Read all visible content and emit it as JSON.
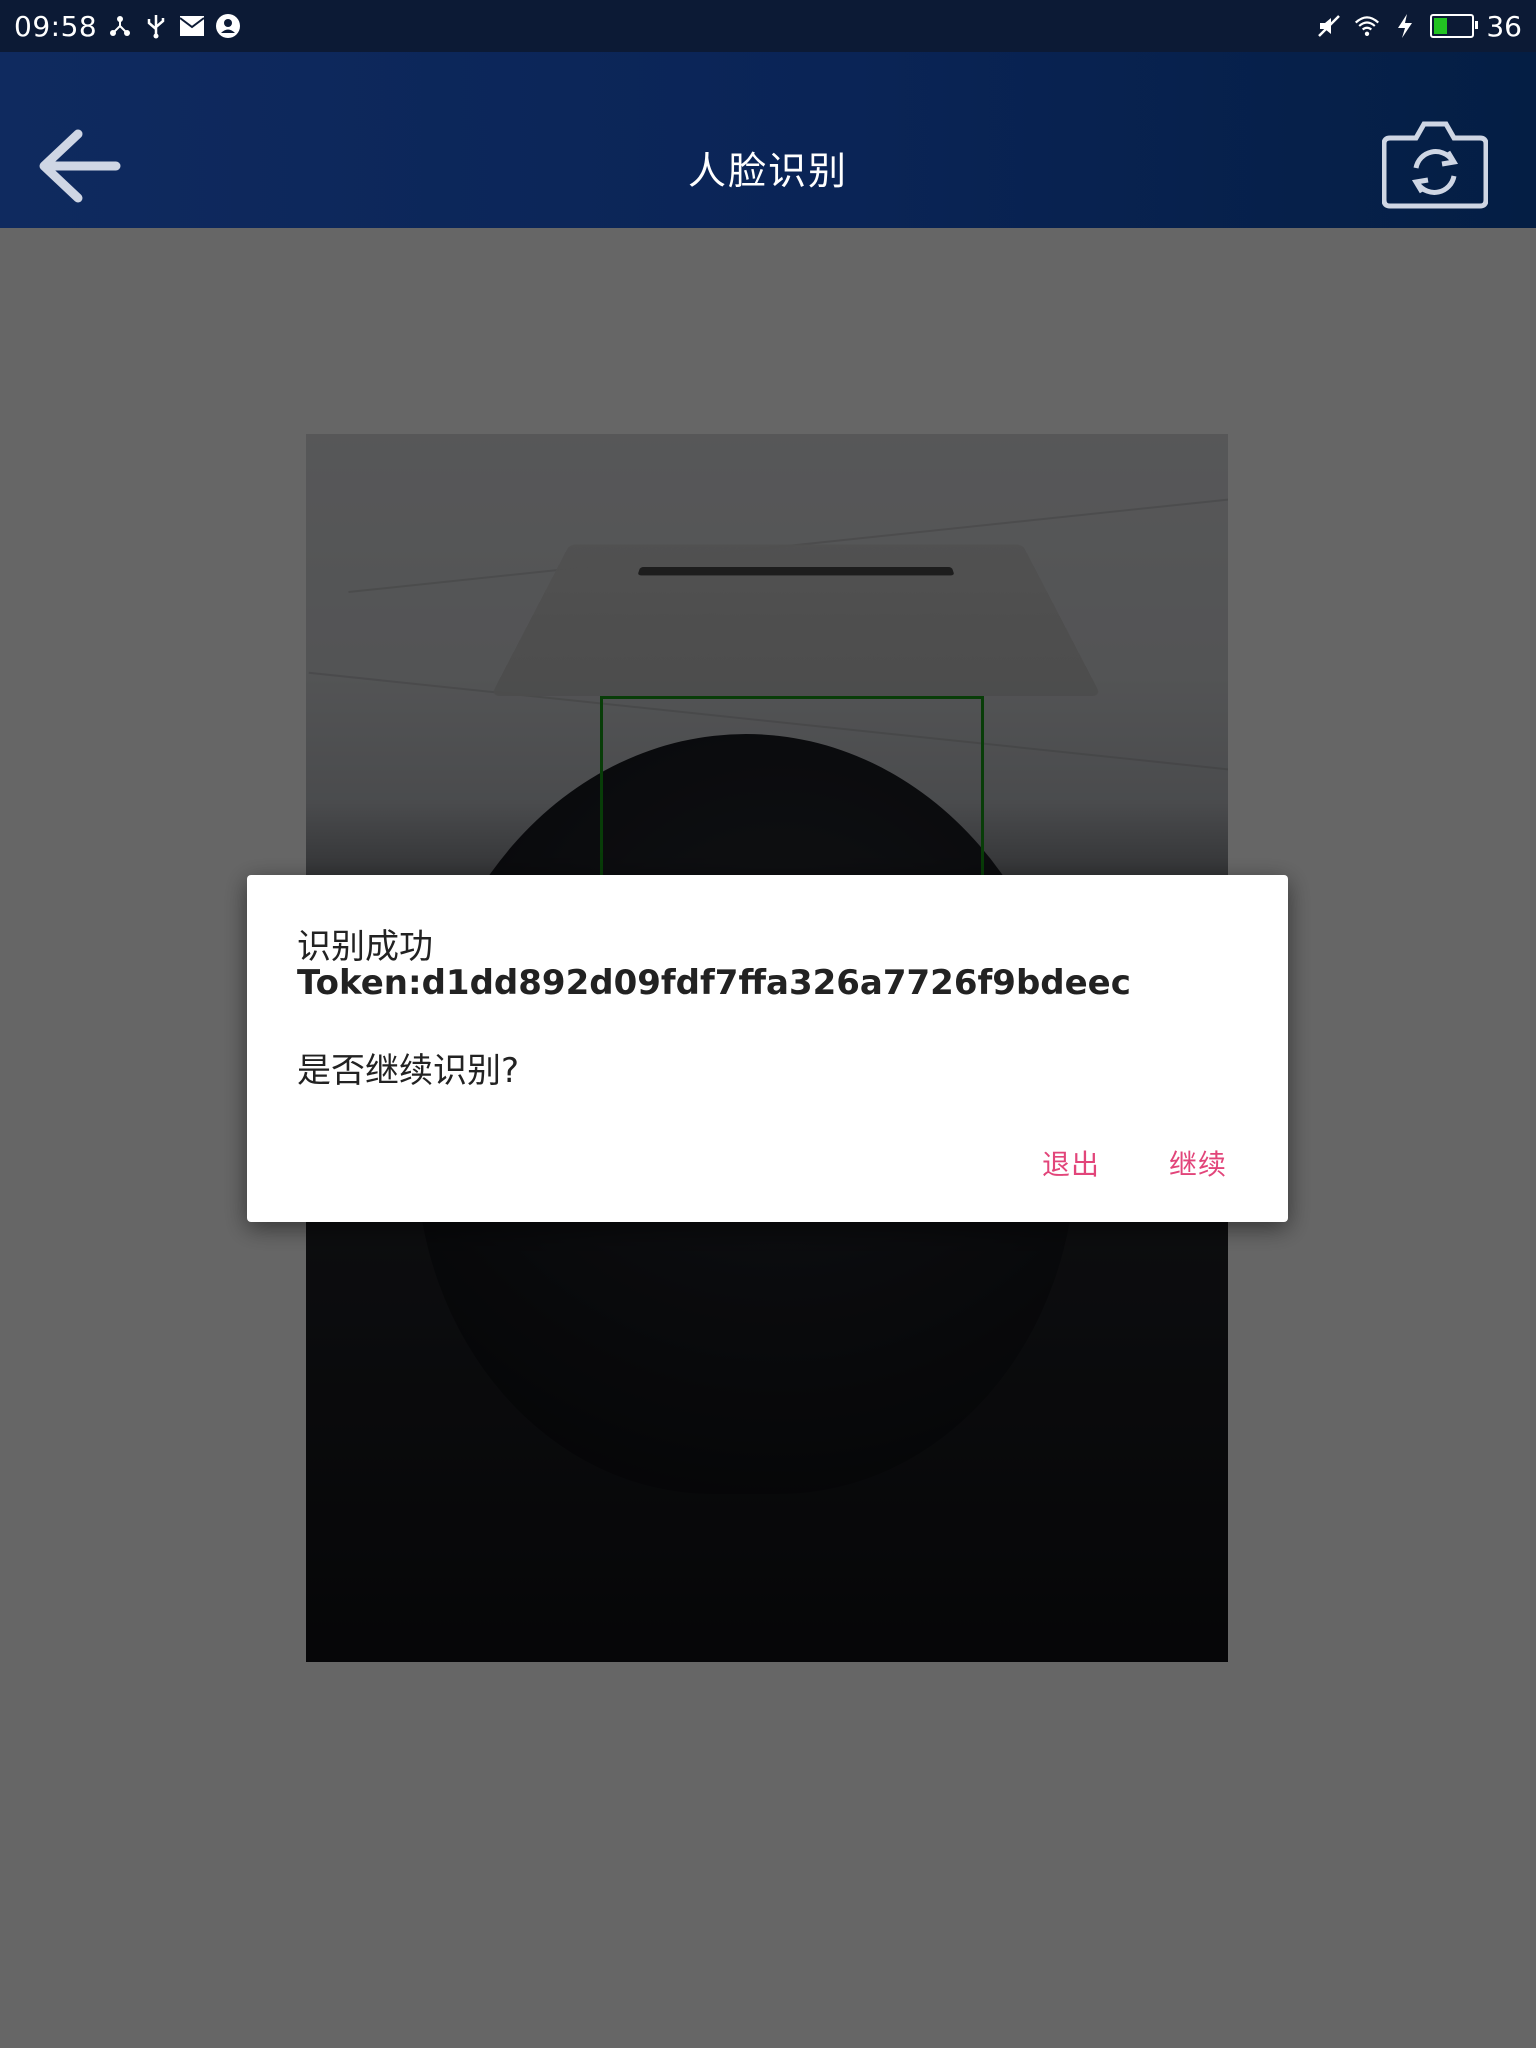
{
  "status_bar": {
    "time": "09:58",
    "battery_level_text": "36",
    "battery_fraction": 0.36,
    "icons": [
      "network-share-icon",
      "usb-icon",
      "mail-icon",
      "account-icon",
      "mute-icon",
      "wifi-icon",
      "charging-icon",
      "battery-icon"
    ]
  },
  "app_bar": {
    "title": "人脸识别",
    "back_icon": "arrow-left-icon",
    "switch_camera_icon": "camera-switch-icon"
  },
  "camera": {
    "face_box_color": "#159915"
  },
  "dialog": {
    "line1": "识别成功",
    "line2": "Token:d1dd892d09fdf7ffa326a7726f9bdeec",
    "line3": "是否继续识别?",
    "buttons": {
      "exit": "退出",
      "continue": "继续"
    },
    "accent_color": "#e2457a"
  }
}
